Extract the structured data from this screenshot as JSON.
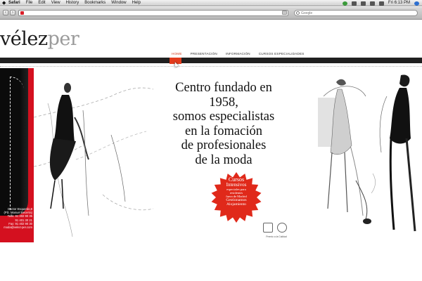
{
  "menubar": {
    "apple": "",
    "items": [
      "Safari",
      "File",
      "Edit",
      "View",
      "History",
      "Bookmarks",
      "Window",
      "Help"
    ],
    "clock": "Fri 6:13 PM"
  },
  "toolbar": {
    "url": "",
    "search_placeholder": "Google"
  },
  "site": {
    "logo_prefix": "vélez",
    "logo_suffix": "per",
    "nav": [
      {
        "label": "HOME",
        "active": true
      },
      {
        "label": "PRESENTACIÓN",
        "active": false
      },
      {
        "label": "INFORMACIÓN",
        "active": false
      },
      {
        "label": "CURSOS ESPECIALIDADES",
        "active": false
      }
    ]
  },
  "hero": {
    "headline_lines": [
      "Centro fundado en",
      "1958,",
      "somos especialistas",
      "en la fomación",
      "de profesionales",
      "de la moda"
    ],
    "badge": {
      "line1": "Cursos",
      "line2": "Intensivos",
      "line3": "especiales para",
      "line4": "residentes",
      "line5": "fuera de Madrid",
      "line6": "Gestionamos",
      "line7": "Alojamiento",
      "color": "#e0291a"
    },
    "address_lines": [
      "Doctor Esquerdo,8",
      "(Plz. Manuel Becerra)",
      "Telfs: 91 402 90 35",
      "91 401 30 21",
      "Fax: 91 402 90 30",
      "moda@velez-per.com"
    ],
    "quality_label": "Premio a la Calidad"
  },
  "colors": {
    "accent": "#e23b1c",
    "navbar": "#202020",
    "left_panel": "#d4101f"
  }
}
